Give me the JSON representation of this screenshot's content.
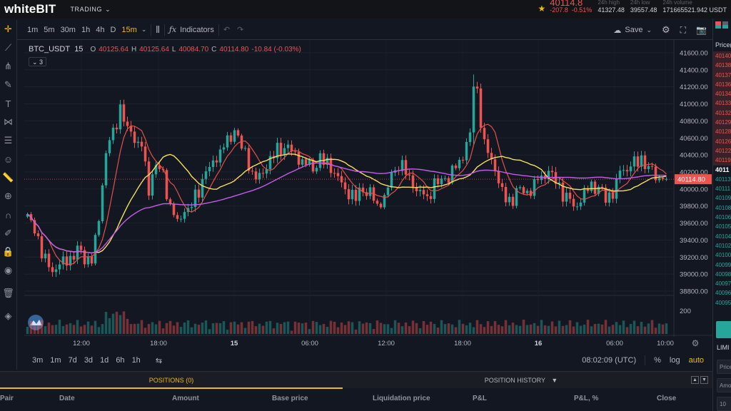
{
  "header": {
    "logo_main": "white",
    "logo_bold": "BIT",
    "nav_label": "TRADING",
    "last_price": "40114.8",
    "change_abs": "-207.8",
    "change_pct": "-0.51%",
    "high_label": "24h high",
    "high_value": "41327.48",
    "low_label": "24h low",
    "low_value": "39557.48",
    "volume_label": "24h volume",
    "volume_value": "171665521.942 USDT"
  },
  "toolbar": {
    "timeframes": [
      "1m",
      "5m",
      "30m",
      "1h",
      "4h",
      "D",
      "15m"
    ],
    "active_timeframe": "15m",
    "indicators_label": "Indicators",
    "save_label": "Save"
  },
  "legend": {
    "symbol": "BTC_USDT",
    "interval": "15",
    "open_label": "O",
    "open": "40125.64",
    "high_label": "H",
    "high": "40125.64",
    "low_label": "L",
    "low": "40084.70",
    "close_label": "C",
    "close": "40114.80",
    "change": "-10.84 (-0.03%)",
    "indicator_count": "3"
  },
  "chart_data": {
    "type": "candlestick",
    "price_axis_ticks": [
      "41600.00",
      "41400.00",
      "41200.00",
      "41000.00",
      "40800.00",
      "40600.00",
      "40400.00",
      "40200.00",
      "40000.00",
      "39800.00",
      "39600.00",
      "39400.00",
      "39200.00",
      "39000.00",
      "38800.00"
    ],
    "price_range": [
      38750,
      41700
    ],
    "current_price": "40114.80",
    "volume_tick": "200",
    "time_ticks": [
      "12:00",
      "18:00",
      "15",
      "06:00",
      "12:00",
      "18:00",
      "16",
      "06:00",
      "10:00"
    ],
    "close_path_anchors": [
      [
        0,
        39650
      ],
      [
        2,
        39550
      ],
      [
        4,
        39250
      ],
      [
        6,
        39080
      ],
      [
        8,
        39060
      ],
      [
        10,
        39150
      ],
      [
        12,
        39180
      ],
      [
        14,
        39280
      ],
      [
        16,
        39200
      ],
      [
        18,
        39150
      ],
      [
        20,
        39650
      ],
      [
        22,
        40450
      ],
      [
        24,
        40650
      ],
      [
        26,
        40950
      ],
      [
        28,
        40700
      ],
      [
        30,
        40600
      ],
      [
        32,
        40500
      ],
      [
        34,
        40000
      ],
      [
        36,
        40300
      ],
      [
        38,
        40150
      ],
      [
        40,
        39800
      ],
      [
        42,
        39600
      ],
      [
        44,
        39750
      ],
      [
        46,
        39800
      ],
      [
        48,
        40000
      ],
      [
        50,
        40200
      ],
      [
        52,
        40300
      ],
      [
        54,
        40450
      ],
      [
        56,
        40550
      ],
      [
        58,
        40700
      ],
      [
        60,
        40500
      ],
      [
        62,
        40300
      ],
      [
        64,
        40100
      ],
      [
        66,
        40200
      ],
      [
        68,
        40350
      ],
      [
        70,
        40450
      ],
      [
        72,
        40500
      ],
      [
        74,
        40450
      ],
      [
        76,
        40350
      ],
      [
        78,
        40300
      ],
      [
        80,
        40250
      ],
      [
        82,
        40350
      ],
      [
        84,
        40300
      ],
      [
        86,
        40200
      ],
      [
        88,
        40050
      ],
      [
        90,
        39950
      ],
      [
        92,
        39900
      ],
      [
        94,
        40000
      ],
      [
        96,
        39950
      ],
      [
        98,
        39800
      ],
      [
        100,
        39900
      ],
      [
        102,
        40150
      ],
      [
        104,
        40300
      ],
      [
        106,
        40200
      ],
      [
        108,
        40050
      ],
      [
        110,
        39950
      ],
      [
        112,
        39900
      ],
      [
        114,
        40050
      ],
      [
        116,
        40100
      ],
      [
        118,
        40150
      ],
      [
        120,
        40250
      ],
      [
        122,
        40400
      ],
      [
        124,
        40650
      ],
      [
        125,
        41200
      ],
      [
        126,
        41150
      ],
      [
        128,
        40500
      ],
      [
        130,
        40350
      ],
      [
        132,
        40100
      ],
      [
        134,
        39850
      ],
      [
        136,
        39900
      ],
      [
        138,
        40000
      ],
      [
        140,
        39950
      ],
      [
        142,
        40050
      ],
      [
        144,
        40150
      ],
      [
        146,
        40200
      ],
      [
        148,
        40100
      ],
      [
        150,
        39950
      ],
      [
        152,
        39850
      ],
      [
        154,
        39800
      ],
      [
        156,
        39950
      ],
      [
        158,
        40050
      ],
      [
        160,
        40000
      ],
      [
        162,
        39900
      ],
      [
        164,
        39950
      ],
      [
        166,
        40200
      ],
      [
        168,
        40250
      ],
      [
        170,
        40300
      ],
      [
        172,
        40350
      ],
      [
        174,
        40250
      ],
      [
        176,
        40150
      ],
      [
        178,
        40114.8
      ]
    ]
  },
  "bottom_bar": {
    "ranges": [
      "3m",
      "1m",
      "7d",
      "3d",
      "1d",
      "6h",
      "1h"
    ],
    "time": "08:02:09 (UTC)",
    "pct": "%",
    "log": "log",
    "auto": "auto"
  },
  "positions": {
    "tab_positions": "POSITIONS (0)",
    "tab_history": "POSITION HISTORY",
    "columns": [
      "Pair",
      "Date",
      "Amount",
      "Base price",
      "Liquidation price",
      "P&L",
      "P&L, %",
      "Close"
    ]
  },
  "orderbook": {
    "price_label": "Price(",
    "asks": [
      "40140",
      "40138",
      "40137",
      "40136",
      "40134",
      "40133",
      "40132",
      "40129",
      "40128",
      "40126",
      "40122",
      "40119"
    ],
    "mid": "4011",
    "bids": [
      "40113",
      "40111",
      "40109",
      "40108",
      "40106",
      "40105",
      "40104",
      "40102",
      "40100",
      "40099",
      "40098",
      "40097",
      "40096",
      "40095"
    ],
    "limit_label": "LIMI",
    "input_price": "Price",
    "input_amount": "Amo",
    "input_total": "10"
  }
}
